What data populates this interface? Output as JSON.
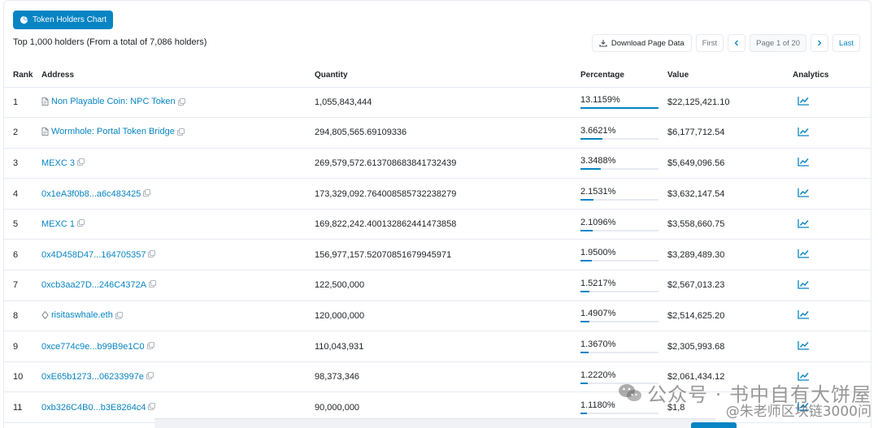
{
  "chart_button": {
    "label": "Token Holders Chart",
    "icon": "pie-chart-icon"
  },
  "summary": "Top 1,000 holders (From a total of 7,086 holders)",
  "toolbar": {
    "download_label": "Download Page Data",
    "download_icon": "download-icon",
    "first_label": "First",
    "prev_icon": "chevron-left-icon",
    "page_info": "Page 1 of 20",
    "next_icon": "chevron-right-icon",
    "last_label": "Last"
  },
  "table": {
    "headers": {
      "rank": "Rank",
      "address": "Address",
      "quantity": "Quantity",
      "percentage": "Percentage",
      "value": "Value",
      "analytics": "Analytics"
    },
    "rows": [
      {
        "rank": "1",
        "address": "Non Playable Coin: NPC Token",
        "address_icon": "document-icon",
        "quantity": "1,055,843,444",
        "percentage": "13.1159%",
        "pct_value": 13.1159,
        "value": "$22,125,421.10"
      },
      {
        "rank": "2",
        "address": "Wormhole: Portal Token Bridge",
        "address_icon": "document-icon",
        "quantity": "294,805,565.69109336",
        "percentage": "3.6621%",
        "pct_value": 3.6621,
        "value": "$6,177,712.54"
      },
      {
        "rank": "3",
        "address": "MEXC 3",
        "address_icon": "",
        "quantity": "269,579,572.613708683841732439",
        "percentage": "3.3488%",
        "pct_value": 3.3488,
        "value": "$5,649,096.56"
      },
      {
        "rank": "4",
        "address": "0x1eA3f0b8...a6c483425",
        "address_icon": "",
        "quantity": "173,329,092.764008585732238279",
        "percentage": "2.1531%",
        "pct_value": 2.1531,
        "value": "$3,632,147.54"
      },
      {
        "rank": "5",
        "address": "MEXC 1",
        "address_icon": "",
        "quantity": "169,822,242.400132862441473858",
        "percentage": "2.1096%",
        "pct_value": 2.1096,
        "value": "$3,558,660.75"
      },
      {
        "rank": "6",
        "address": "0x4D458D47...164705357",
        "address_icon": "",
        "quantity": "156,977,157.52070851679945971",
        "percentage": "1.9500%",
        "pct_value": 1.95,
        "value": "$3,289,489.30"
      },
      {
        "rank": "7",
        "address": "0xcb3aa27D...246C4372A",
        "address_icon": "",
        "quantity": "122,500,000",
        "percentage": "1.5217%",
        "pct_value": 1.5217,
        "value": "$2,567,013.23"
      },
      {
        "rank": "8",
        "address": "risitaswhale.eth",
        "address_icon": "ens-icon",
        "quantity": "120,000,000",
        "percentage": "1.4907%",
        "pct_value": 1.4907,
        "value": "$2,514,625.20"
      },
      {
        "rank": "9",
        "address": "0xce774c9e...b99B9e1C0",
        "address_icon": "",
        "quantity": "110,043,931",
        "percentage": "1.3670%",
        "pct_value": 1.367,
        "value": "$2,305,993.68"
      },
      {
        "rank": "10",
        "address": "0xE65b1273...06233997e",
        "address_icon": "",
        "quantity": "98,373,346",
        "percentage": "1.2220%",
        "pct_value": 1.222,
        "value": "$2,061,434.12"
      },
      {
        "rank": "11",
        "address": "0xb326C4B0...b3E8264c4",
        "address_icon": "",
        "quantity": "90,000,000",
        "percentage": "1.1180%",
        "pct_value": 1.118,
        "value": "$1,8"
      }
    ]
  },
  "watermark": {
    "line1": "公众号 · 书中自有大饼屋",
    "line2": "@朱老师区块链3000问"
  },
  "colors": {
    "accent": "#0784c3",
    "border": "#e7eaf3"
  }
}
